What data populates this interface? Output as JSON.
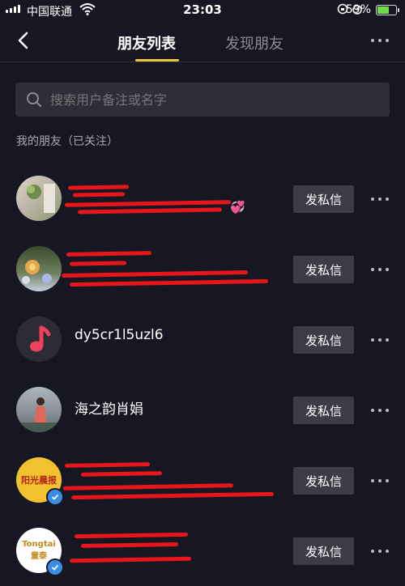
{
  "status_bar": {
    "carrier": "中国联通",
    "time": "23:03",
    "battery": "59%"
  },
  "header": {
    "tab_active": "朋友列表",
    "tab_other": "发现朋友"
  },
  "search": {
    "placeholder": "搜索用户备注或名字"
  },
  "section_label": "我的朋友（已关注）",
  "friends": [
    {
      "name": "",
      "emoji": "💞",
      "button": "发私信"
    },
    {
      "name": "",
      "button": "发私信"
    },
    {
      "name": "dy5cr1l5uzl6",
      "button": "发私信"
    },
    {
      "name": "海之韵肖娟",
      "button": "发私信"
    },
    {
      "name": "",
      "avatar_text": "阳光晨报",
      "button": "发私信"
    },
    {
      "name": "",
      "avatar_text": "Tongtai 童泰",
      "button": "发私信"
    }
  ],
  "colors": {
    "background": "#161722",
    "accent": "#f0c33c",
    "button": "#3b3c48",
    "redaction": "#e6161b"
  }
}
